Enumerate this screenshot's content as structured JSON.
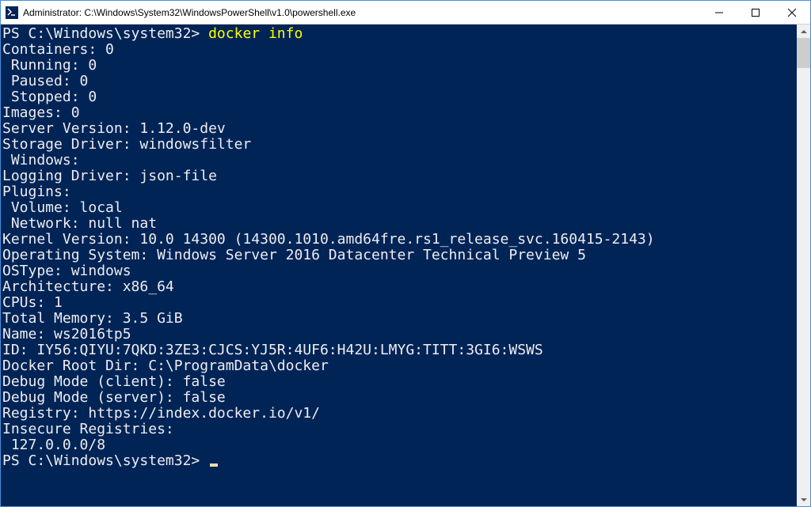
{
  "window": {
    "title": "Administrator: C:\\Windows\\System32\\WindowsPowerShell\\v1.0\\powershell.exe"
  },
  "prompt1": "PS C:\\Windows\\system32> ",
  "command": "docker info",
  "output": "Containers: 0\n Running: 0\n Paused: 0\n Stopped: 0\nImages: 0\nServer Version: 1.12.0-dev\nStorage Driver: windowsfilter\n Windows:\nLogging Driver: json-file\nPlugins:\n Volume: local\n Network: null nat\nKernel Version: 10.0 14300 (14300.1010.amd64fre.rs1_release_svc.160415-2143)\nOperating System: Windows Server 2016 Datacenter Technical Preview 5\nOSType: windows\nArchitecture: x86_64\nCPUs: 1\nTotal Memory: 3.5 GiB\nName: ws2016tp5\nID: IY56:QIYU:7QKD:3ZE3:CJCS:YJ5R:4UF6:H42U:LMYG:TITT:3GI6:WSWS\nDocker Root Dir: C:\\ProgramData\\docker\nDebug Mode (client): false\nDebug Mode (server): false\nRegistry: https://index.docker.io/v1/\nInsecure Registries:\n 127.0.0.0/8",
  "prompt2": "PS C:\\Windows\\system32> "
}
